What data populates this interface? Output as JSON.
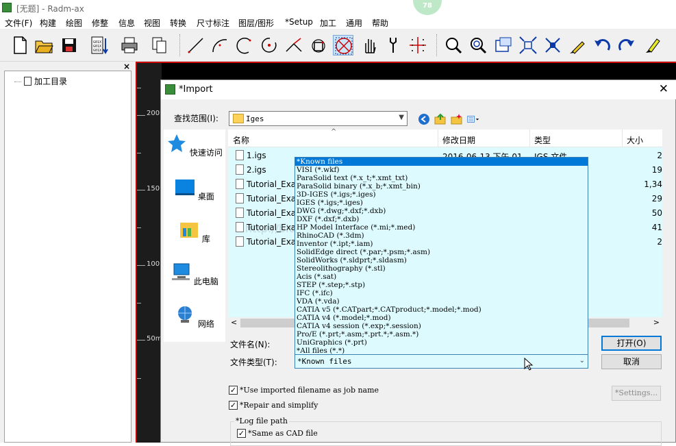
{
  "window": {
    "title": "[无题] - Radm-ax",
    "badge": "78"
  },
  "menu": [
    "文件(F)",
    "构建",
    "绘图",
    "修整",
    "信息",
    "视图",
    "转换",
    "尺寸标注",
    "图层/图形",
    "*Setup",
    "加工",
    "通用",
    "帮助"
  ],
  "tree": {
    "close": "×",
    "root_label": "加工目录"
  },
  "ruler": {
    "labels": [
      "200",
      "150",
      "100",
      "50m"
    ]
  },
  "dialog": {
    "title": "*Import",
    "close": "✕",
    "look_in_label": "查找范围(I):",
    "look_in_value": "Iges",
    "places": [
      "快速访问",
      "桌面",
      "库",
      "此电脑",
      "网络"
    ],
    "columns": {
      "name": "名称",
      "date": "修改日期",
      "type": "类型",
      "size": "大小"
    },
    "files": [
      {
        "name": "1.igs",
        "date": "2016-06-13 下午 01",
        "type": "IGS 文件",
        "size": "2"
      },
      {
        "name": "2.igs",
        "date": "",
        "type": "",
        "size": "19"
      },
      {
        "name": "Tutorial_Exa",
        "date": "",
        "type": "",
        "size": "1,34"
      },
      {
        "name": "Tutorial_Exa",
        "date": "",
        "type": "",
        "size": "29"
      },
      {
        "name": "Tutorial_Exa",
        "date": "",
        "type": "",
        "size": "50"
      },
      {
        "name": "Tutorial_Exa",
        "date": "",
        "type": "",
        "size": "41"
      },
      {
        "name": "Tutorial_Exa",
        "date": "",
        "type": "",
        "size": "2"
      }
    ],
    "file_name_label": "文件名(N):",
    "file_type_label": "文件类型(T):",
    "file_type_value": "*Known files",
    "open_button": "打开(O)",
    "cancel_button": "取消",
    "file_types": [
      "*Known files",
      "VISI (*.wkf)",
      "ParaSolid text (*.x_t;*.xmt_txt)",
      "ParaSolid binary (*.x_b;*.xmt_bin)",
      "3D-IGES (*.igs;*.iges)",
      "IGES (*.igs;*.iges)",
      "DWG (*.dwg;*.dxf;*.dxb)",
      "DXF (*.dxf;*.dxb)",
      "HP Model Interface (*.mi;*.med)",
      "RhinoCAD (*.3dm)",
      "Inventor (*.ipt;*.iam)",
      "SolidEdge direct (*.par;*.psm;*.asm)",
      "SolidWorks (*.sldprt;*.sldasm)",
      "Stereolithography (*.stl)",
      "Acis (*.sat)",
      "STEP (*.step;*.stp)",
      "IFC (*.ifc)",
      "VDA (*.vda)",
      "CATIA v5 (*.CATpart;*.CATproduct;*.model;*.mod)",
      "CATIA v4 (*.model;*.mod)",
      "CATIA v4 session (*.exp;*.session)",
      "Pro/E (*.prt;*.asm;*.prt.*;*.asm.*)",
      "UniGraphics (*.prt)",
      "*All files (*.*)"
    ],
    "use_filename": "*Use imported filename as job name",
    "repair": "*Repair and simplify",
    "settings_button": "*Settings...",
    "log_legend": "*Log file path",
    "same_as_cad": "*Same as CAD file",
    "watermark": "http://blog.csdn.net/dasort123"
  },
  "colors": {
    "canvas": "#000000",
    "accent": "#0078d7",
    "dropdown_bg": "#ddfbff",
    "icon_blue": "#0b3aa8",
    "icon_red": "#cc0000"
  }
}
